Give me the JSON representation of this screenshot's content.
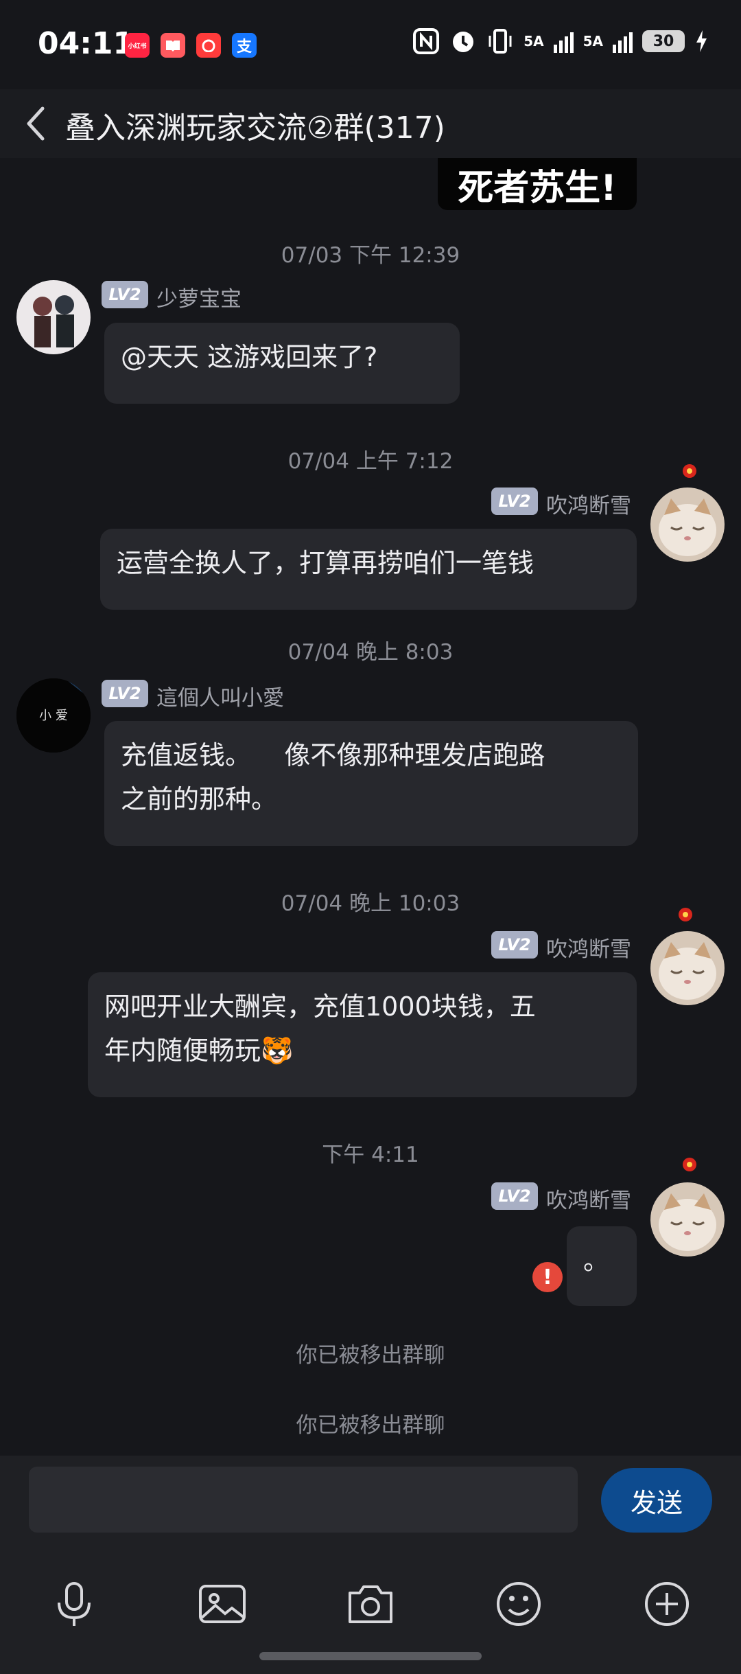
{
  "status_bar": {
    "time": "04:11",
    "apps": [
      {
        "name": "xiaohongshu",
        "label": "小红书",
        "color": "#ff2442"
      },
      {
        "name": "reader",
        "label": "",
        "color": "#ff5a5f"
      },
      {
        "name": "weibo",
        "label": "",
        "color": "#ff3b3b"
      },
      {
        "name": "alipay",
        "label": "支",
        "color": "#1677ff"
      }
    ],
    "network_1": "5A",
    "network_2": "5A",
    "battery": "30"
  },
  "header": {
    "title": "叠入深渊玩家交流②群(317)"
  },
  "chat": {
    "sticker_text": "死者苏生!",
    "messages": [
      {
        "timestamp": "07/03 下午 12:39",
        "level": "LV2",
        "nickname": "少萝宝宝",
        "text": "@天天 这游戏回来了?"
      },
      {
        "timestamp": "07/04 上午 7:12",
        "level": "LV2",
        "nickname": "吹鸿断雪",
        "text": "运营全换人了，打算再捞咱们一笔钱"
      },
      {
        "timestamp": "07/04 晚上 8:03",
        "level": "LV2",
        "nickname": "這個人叫小愛",
        "text_line1": "充值返钱。    像不像那种理发店跑路",
        "text_line2": "之前的那种。",
        "avatar_text": "小 爱"
      },
      {
        "timestamp": "07/04 晚上 10:03",
        "level": "LV2",
        "nickname": "吹鸿断雪",
        "text_line1": "网吧开业大酬宾，充值1000块钱，五",
        "text_line2": "年内随便畅玩🐯"
      },
      {
        "timestamp": "下午 4:11",
        "level": "LV2",
        "nickname": "吹鸿断雪",
        "text": "。",
        "error_mark": "!"
      }
    ],
    "system_notices": [
      "你已被移出群聊",
      "你已被移出群聊"
    ]
  },
  "input_bar": {
    "placeholder": "",
    "send_label": "发送",
    "tools": [
      "microphone-icon",
      "image-icon",
      "camera-icon",
      "emoji-icon",
      "plus-circle-icon"
    ]
  },
  "colors": {
    "background": "#16171b",
    "bubble": "#27282d",
    "send_button": "#0d4b8f",
    "error": "#e5483b",
    "level_badge": "#a8afc4"
  }
}
